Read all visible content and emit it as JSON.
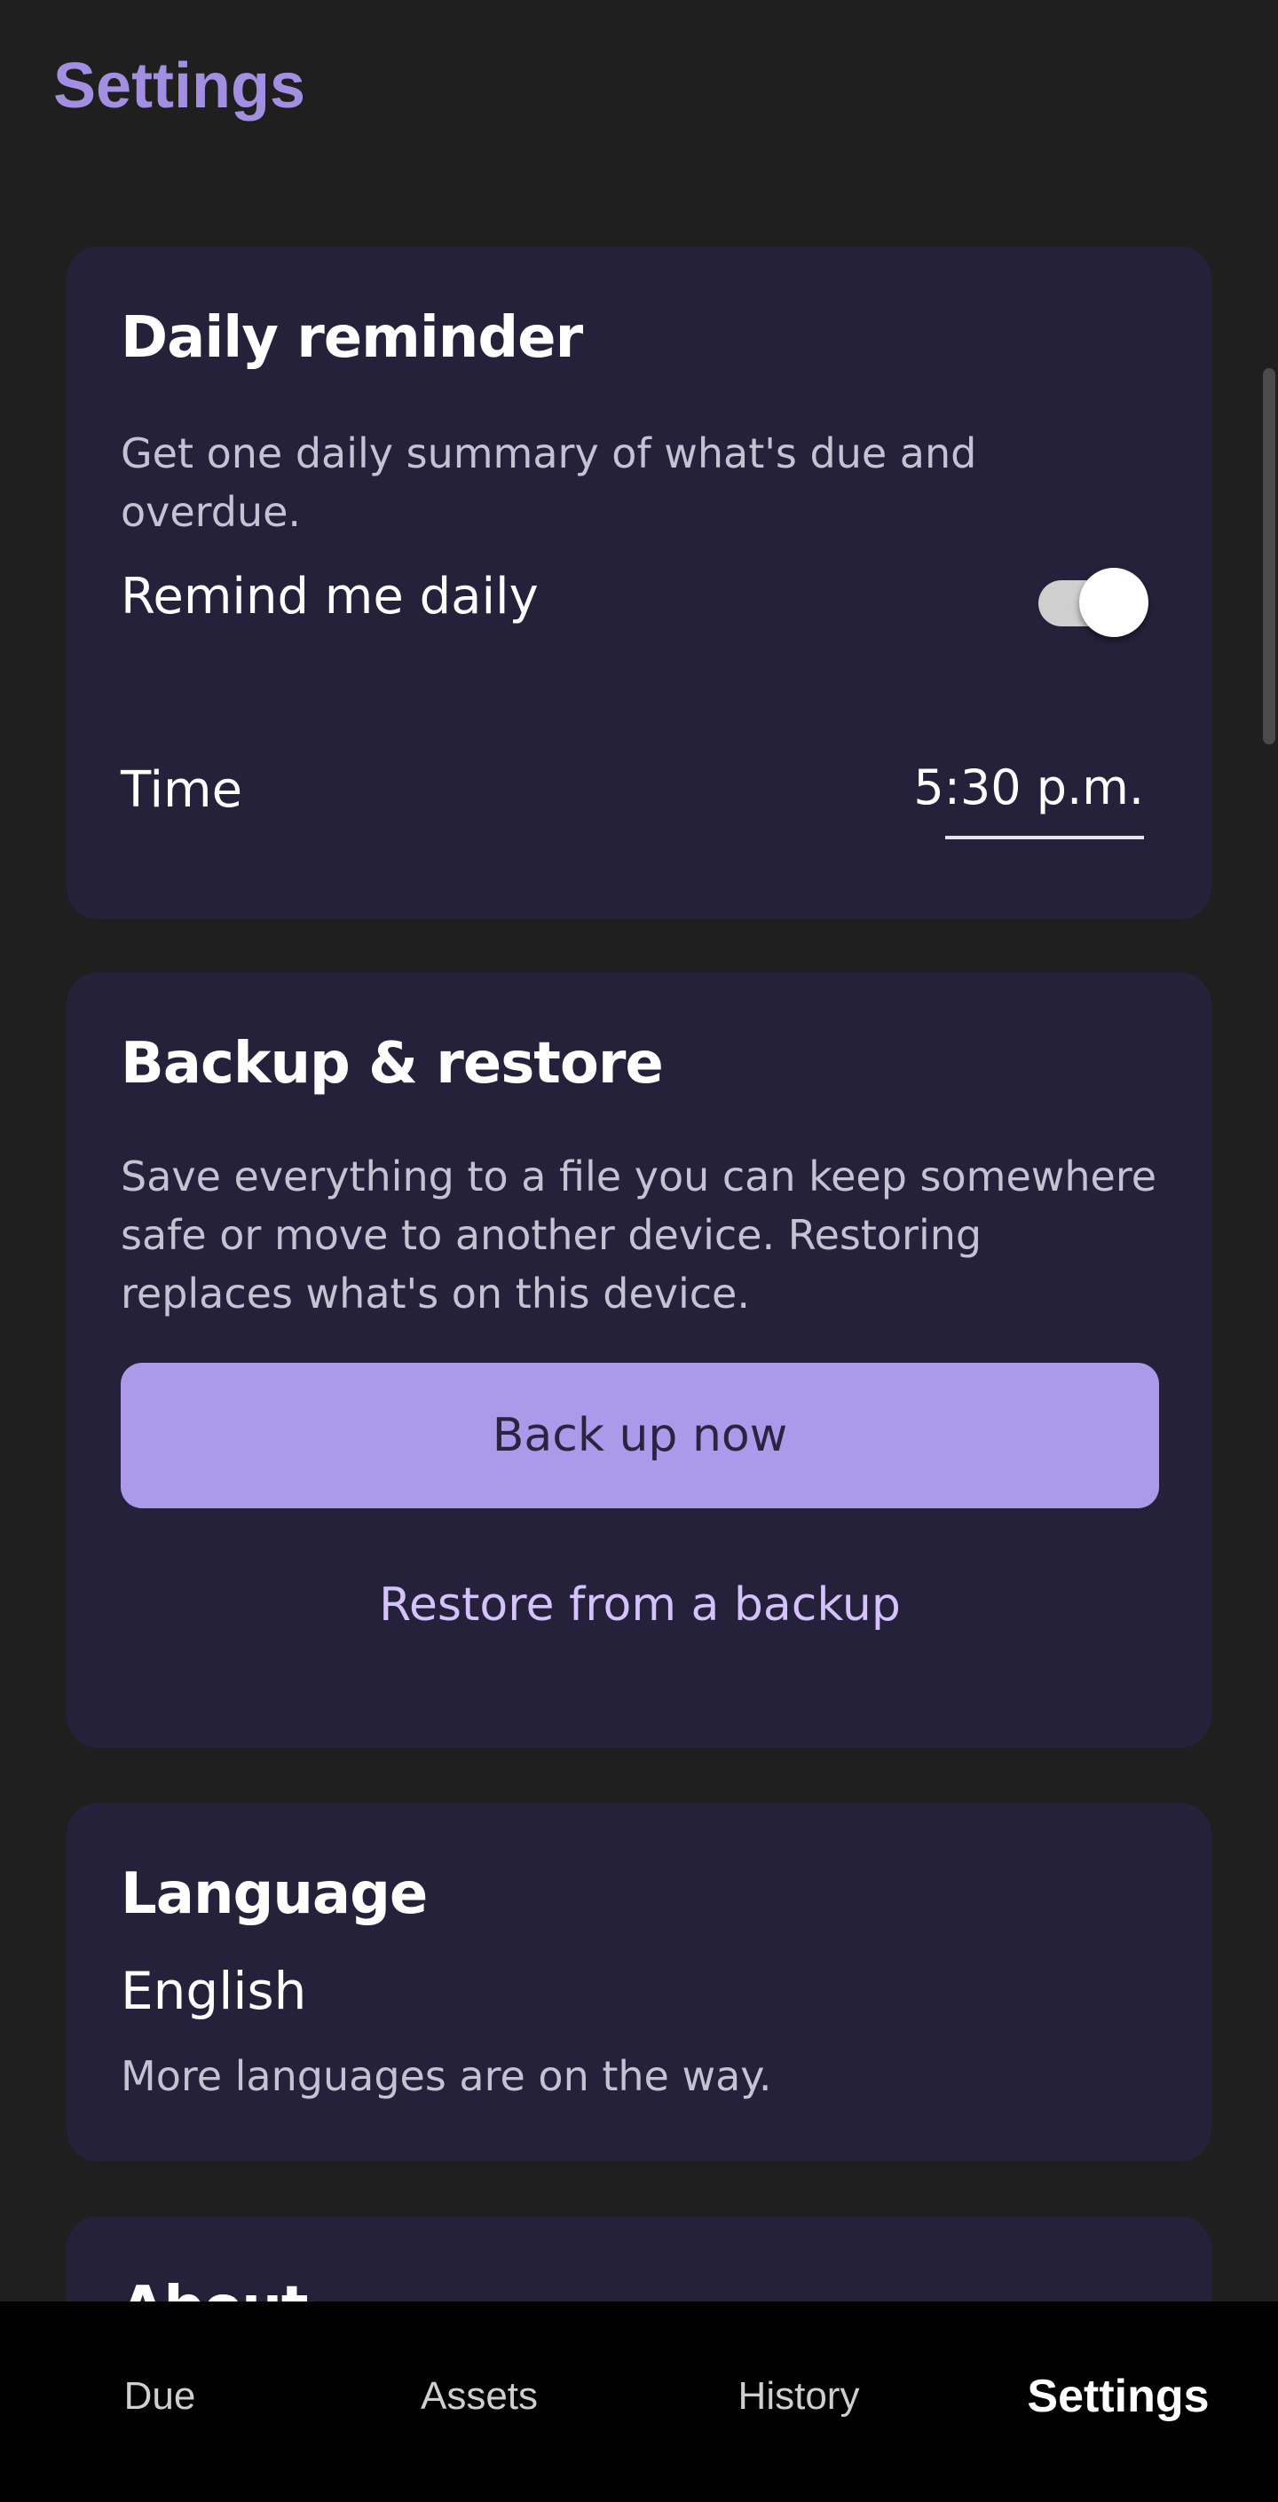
{
  "header": {
    "title": "Settings"
  },
  "reminder": {
    "title": "Daily reminder",
    "description": "Get one daily summary of what's due and overdue.",
    "toggle_label": "Remind me daily",
    "toggle_on": true,
    "time_label": "Time",
    "time_value": "5:30 p.m."
  },
  "backup": {
    "title": "Backup & restore",
    "description": "Save everything to a file you can keep somewhere safe or move to another device. Restoring replaces what's on this device.",
    "backup_button": "Back up now",
    "restore_button": "Restore from a backup"
  },
  "language": {
    "title": "Language",
    "value": "English",
    "note": "More languages are on the way."
  },
  "about": {
    "title": "About"
  },
  "nav": {
    "items": [
      {
        "label": "Due"
      },
      {
        "label": "Assets"
      },
      {
        "label": "History"
      },
      {
        "label": "Settings"
      }
    ],
    "active": "Settings"
  },
  "colors": {
    "accent": "#a28fe2",
    "card": "#26213a",
    "background": "#1f1f1f",
    "primary_button": "#ab99ea",
    "link": "#d3c2fb"
  }
}
